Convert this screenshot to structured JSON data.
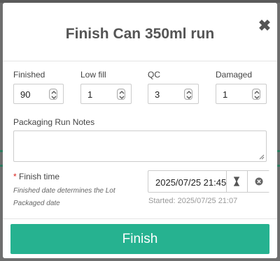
{
  "modal": {
    "title": "Finish Can 350ml run",
    "close_glyph": "✖"
  },
  "quantities": [
    {
      "label": "Finished",
      "value": "90"
    },
    {
      "label": "Low fill",
      "value": "1"
    },
    {
      "label": "QC",
      "value": "3"
    },
    {
      "label": "Damaged",
      "value": "1"
    }
  ],
  "notes": {
    "label": "Packaging Run Notes",
    "value": ""
  },
  "finish_time": {
    "required_mark": "*",
    "label": "Finish time",
    "help_line_1": "Finished date determines the Lot",
    "help_line_2": "Packaged date",
    "value": "2025/07/25 21:45",
    "started": "Started: 2025/07/25 21:07",
    "picker_icon": "hourglass-icon",
    "clear_icon": "clear-circle-icon"
  },
  "footer": {
    "finish_label": "Finish"
  },
  "colors": {
    "accent": "#26b290",
    "required": "#d9231d",
    "overlay": "#6e6e6e"
  }
}
